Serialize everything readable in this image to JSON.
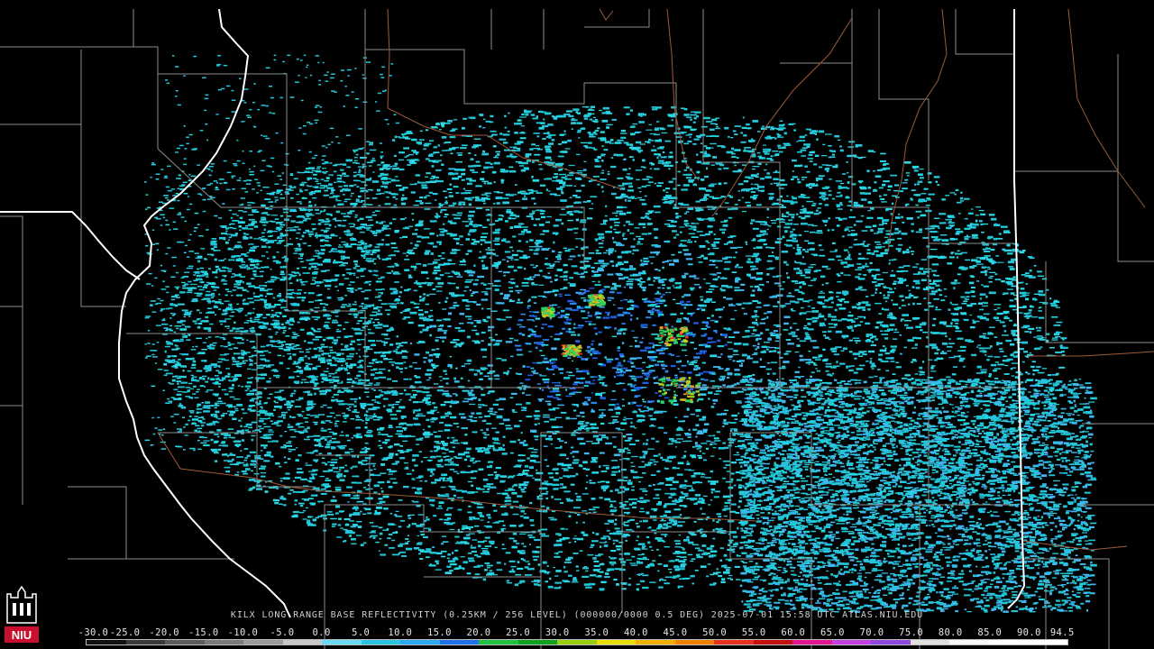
{
  "radar_map": {
    "caption": "KILX LONG RANGE BASE REFLECTIVITY (0.25KM / 256 LEVEL) (000000/0000 0.5 DEG) 2025-07-01 15:58 UTC  ATLAS.NIU.EDU",
    "logo_text": "NIU",
    "product": "base-reflectivity",
    "boundary_colors": {
      "state": "#ffffff",
      "county": "#8c8c8c",
      "river": "#a05a3a"
    },
    "echo_palette": [
      "#22c6d8",
      "#28d8e6",
      "#3fb6f0",
      "#2a86ee",
      "#1e5ee0",
      "#2ad060",
      "#b8d020",
      "#f0a020",
      "#e83020"
    ],
    "scale": {
      "labels": [
        "-30.0",
        "-25.0",
        "-20.0",
        "-15.0",
        "-10.0",
        "-5.0",
        "0.0",
        "5.0",
        "10.0",
        "15.0",
        "20.0",
        "25.0",
        "30.0",
        "35.0",
        "40.0",
        "45.0",
        "50.0",
        "55.0",
        "60.0",
        "65.0",
        "70.0",
        "75.0",
        "80.0",
        "85.0",
        "90.0",
        "94.5"
      ],
      "colors": [
        "#101010",
        "#3a3a3a",
        "#5c5c5c",
        "#7a7a7a",
        "#9a9a9a",
        "#c8c8c8",
        "#6ad8f0",
        "#2ac4e0",
        "#2aa8f0",
        "#2070e8",
        "#20c040",
        "#10a020",
        "#98d010",
        "#e8e000",
        "#f0b000",
        "#f08000",
        "#e83020",
        "#c01010",
        "#e01890",
        "#c040e0",
        "#9048e0",
        "#e0e0e0",
        "#f8f8f8",
        "#ffffff",
        "#ffffff"
      ]
    }
  }
}
